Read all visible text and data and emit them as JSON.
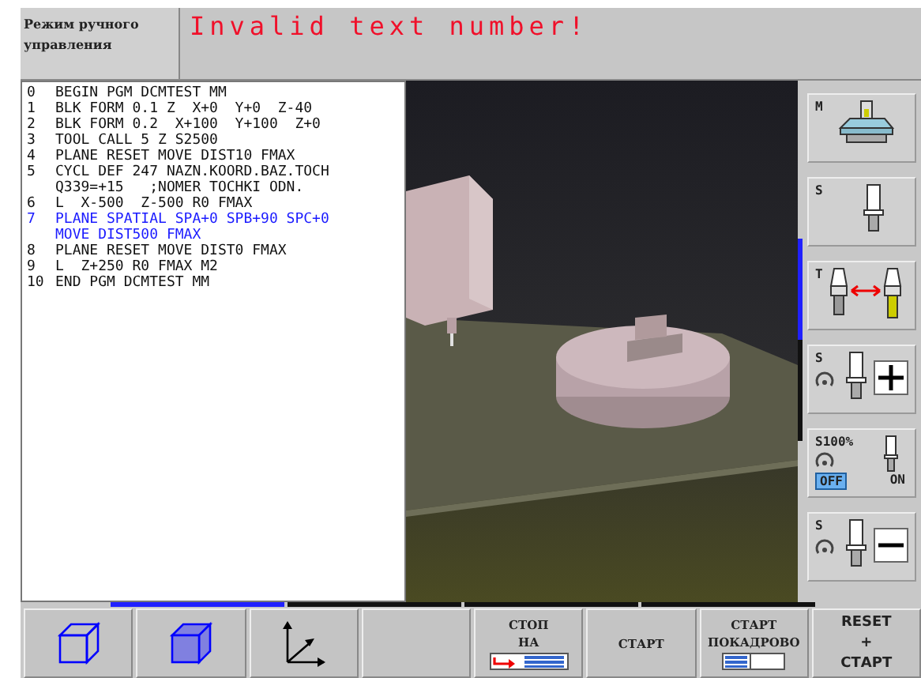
{
  "header": {
    "mode": "Режим ручного управления",
    "message": "Invalid text number!"
  },
  "program": {
    "lines": [
      {
        "number": "0",
        "text": [
          "BEGIN PGM DCMTEST MM"
        ],
        "selected": false
      },
      {
        "number": "1",
        "text": [
          "BLK FORM 0.1 Z  X+0  Y+0  Z-40"
        ],
        "selected": false
      },
      {
        "number": "2",
        "text": [
          "BLK FORM 0.2  X+100  Y+100  Z+0"
        ],
        "selected": false
      },
      {
        "number": "3",
        "text": [
          "TOOL CALL 5 Z S2500"
        ],
        "selected": false
      },
      {
        "number": "4",
        "text": [
          "PLANE RESET MOVE DIST10 FMAX"
        ],
        "selected": false
      },
      {
        "number": "5",
        "text": [
          "CYCL DEF 247 NAZN.KOORD.BAZ.TOCH",
          "Q339=+15   ;NOMER TOCHKI ODN."
        ],
        "selected": false
      },
      {
        "number": "6",
        "text": [
          "L  X-500  Z-500 R0 FMAX"
        ],
        "selected": false
      },
      {
        "number": "7",
        "text": [
          "PLANE SPATIAL SPA+0 SPB+90 SPC+0",
          "MOVE DIST500 FMAX"
        ],
        "selected": true
      },
      {
        "number": "8",
        "text": [
          "PLANE RESET MOVE DIST0 FMAX"
        ],
        "selected": false
      },
      {
        "number": "9",
        "text": [
          "L  Z+250 R0 FMAX M2"
        ],
        "selected": false
      },
      {
        "number": "10",
        "text": [
          "END PGM DCMTEST MM"
        ],
        "selected": false
      }
    ]
  },
  "side_softkey_pages": [
    {
      "selected": true
    },
    {
      "selected": false
    }
  ],
  "side_softkeys": [
    {
      "kind": "machine",
      "label": "M"
    },
    {
      "kind": "spindle",
      "label": "S"
    },
    {
      "kind": "tool",
      "label": "T"
    },
    {
      "kind": "plus",
      "label": "S"
    },
    {
      "kind": "override",
      "label": "S100%",
      "options": [
        {
          "label": "OFF",
          "selected": true
        },
        {
          "label": "ON",
          "selected": false
        }
      ]
    },
    {
      "kind": "minus",
      "label": "S"
    }
  ],
  "softkey_pages": [
    {
      "selected": true
    },
    {
      "selected": false
    },
    {
      "selected": false
    },
    {
      "selected": false
    }
  ],
  "softkeys": [
    {
      "kind": "cube-outline"
    },
    {
      "kind": "cube-filled"
    },
    {
      "kind": "axes"
    },
    {
      "kind": "empty"
    },
    {
      "kind": "stop-at",
      "lines": [
        "СТОП",
        "НА"
      ]
    },
    {
      "kind": "start",
      "lines": [
        "СТАРТ"
      ]
    },
    {
      "kind": "single-block",
      "lines": [
        "СТАРТ",
        "ПОКАДРОВО"
      ]
    },
    {
      "kind": "reset",
      "lines": [
        "RESET",
        "+",
        "СТАРТ"
      ]
    }
  ]
}
